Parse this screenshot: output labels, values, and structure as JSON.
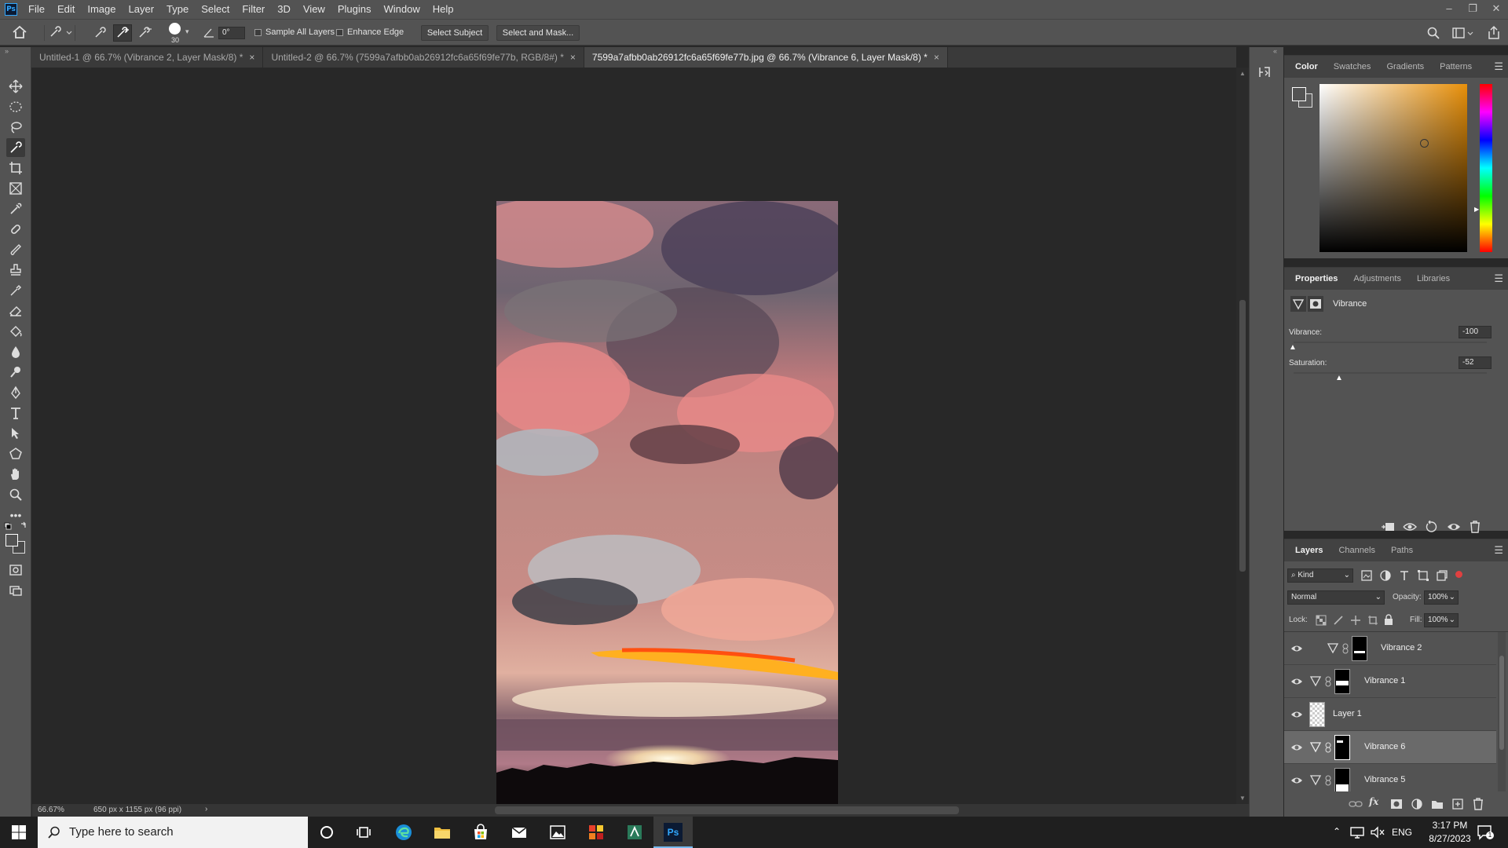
{
  "app": {
    "logo": "Ps"
  },
  "menu": [
    "File",
    "Edit",
    "Image",
    "Layer",
    "Type",
    "Select",
    "Filter",
    "3D",
    "View",
    "Plugins",
    "Window",
    "Help"
  ],
  "window_controls": {
    "minimize": "–",
    "restore": "❐",
    "close": "✕"
  },
  "options_bar": {
    "brush_size": "30",
    "angle": "0°",
    "sample_all_layers": "Sample All Layers",
    "enhance_edge": "Enhance Edge",
    "select_subject": "Select Subject",
    "select_and_mask": "Select and Mask..."
  },
  "tabs": [
    {
      "label": "Untitled-1 @ 66.7% (Vibrance 2, Layer Mask/8) *",
      "close": "×",
      "active": false
    },
    {
      "label": "Untitled-2 @ 66.7% (7599a7afbb0ab26912fc6a65f69fe77b, RGB/8#) *",
      "close": "×",
      "active": false
    },
    {
      "label": "7599a7afbb0ab26912fc6a65f69fe77b.jpg @ 66.7% (Vibrance 6, Layer Mask/8) *",
      "close": "×",
      "active": true
    }
  ],
  "status": {
    "zoom": "66.67%",
    "doc_info": "650 px x 1155 px (96 ppi)",
    "arrow": "›"
  },
  "color_panel": {
    "tabs": [
      "Color",
      "Swatches",
      "Gradients",
      "Patterns"
    ],
    "hue_color": "#e8900a"
  },
  "properties_panel": {
    "tabs": [
      "Properties",
      "Adjustments",
      "Libraries"
    ],
    "title": "Vibrance",
    "vibrance_label": "Vibrance:",
    "vibrance_value": "-100",
    "vibrance_level": 0,
    "saturation_label": "Saturation:",
    "saturation_value": "-52",
    "saturation_level": 0.24
  },
  "layers_panel": {
    "tabs": [
      "Layers",
      "Channels",
      "Paths"
    ],
    "filter_kind": "Kind",
    "blend_mode": "Normal",
    "opacity_label": "Opacity:",
    "opacity_value": "100%",
    "lock_label": "Lock:",
    "fill_label": "Fill:",
    "fill_value": "100%",
    "layers": [
      {
        "name": "Vibrance 2",
        "selected": false
      },
      {
        "name": "Vibrance 1",
        "selected": false
      },
      {
        "name": "Layer 1",
        "selected": false
      },
      {
        "name": "Vibrance 6",
        "selected": true
      },
      {
        "name": "Vibrance 5",
        "selected": false
      }
    ],
    "footer_icons": [
      "link-icon",
      "fx-icon",
      "mask-icon",
      "adjustment-icon",
      "group-icon",
      "new-layer-icon",
      "trash-icon"
    ]
  },
  "taskbar": {
    "search_placeholder": "Type here to search",
    "lang": "ENG",
    "time": "3:17 PM",
    "date": "8/27/2023",
    "notification_count": "1",
    "ps_label": "Ps"
  }
}
